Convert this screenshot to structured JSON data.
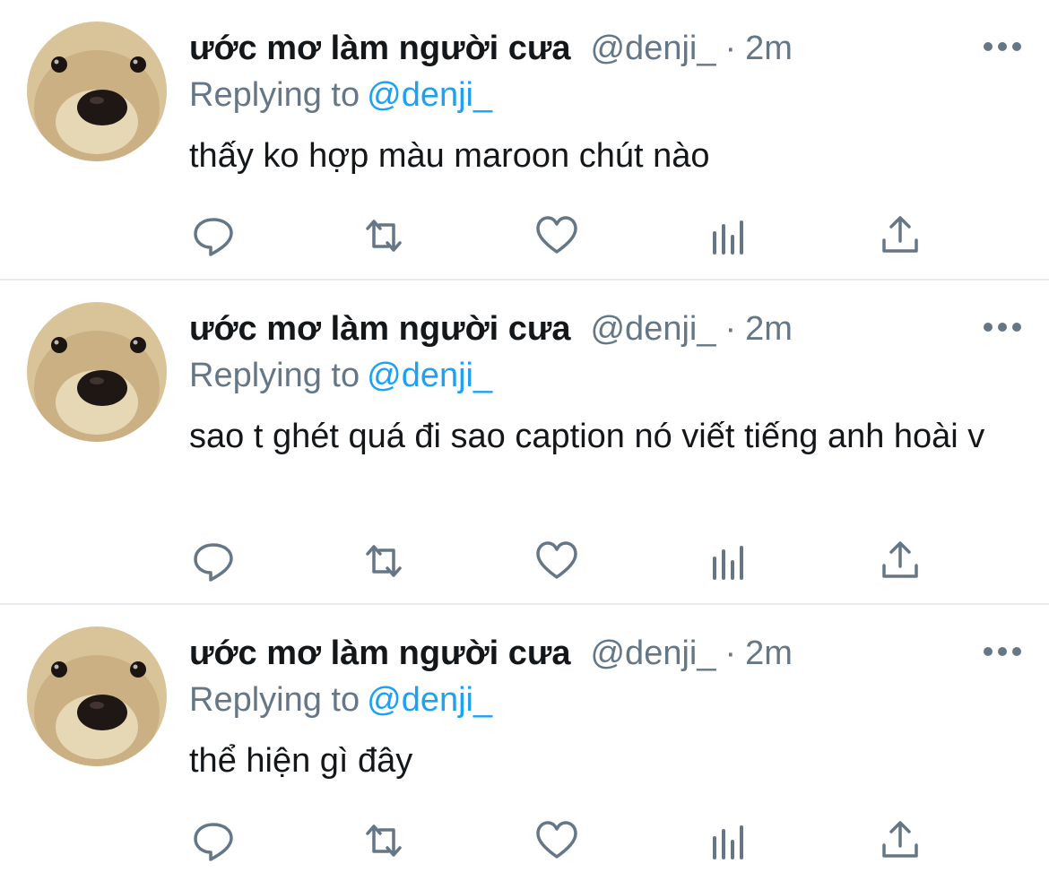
{
  "user": {
    "display_name": "ước mơ làm người cưa",
    "handle": "@denji_",
    "dot": "·",
    "time": "2m",
    "avatar_icon": "dog-face-avatar"
  },
  "replying": {
    "prefix": "Replying to",
    "mention": "@denji_"
  },
  "tweets": [
    {
      "text": "thấy ko hợp màu maroon chút nào"
    },
    {
      "text": "sao t ghét quá đi sao caption nó viết tiếng anh hoài v"
    },
    {
      "text": "thể hiện gì đây"
    }
  ],
  "actions": {
    "icons": [
      "reply-icon",
      "retweet-icon",
      "like-icon",
      "analytics-icon",
      "share-icon"
    ]
  },
  "colors": {
    "text": "#14171a",
    "secondary": "#657786",
    "link": "#1da1f2",
    "divider": "#e6ecf0"
  }
}
